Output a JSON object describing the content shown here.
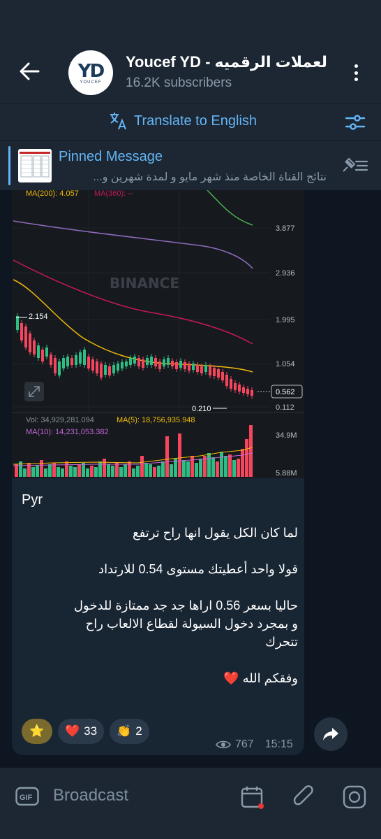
{
  "header": {
    "title": "Youcef YD - لعملات الرقميه",
    "subscribers": "16.2K subscribers",
    "avatar_logo": "YD",
    "avatar_sub": "YOUCEF"
  },
  "translate": {
    "label": "Translate to English"
  },
  "pinned": {
    "title": "Pinned Message",
    "text": "نتائج القناة الخاصة منذ شهر مايو و لمدة شهرين و..."
  },
  "chart": {
    "watermark": "BINANCE",
    "ma200": "MA(200): 4.057",
    "ma360": "MA(360): --",
    "price_labels": [
      "3.877",
      "2.936",
      "1.995",
      "1.054",
      "0.112"
    ],
    "current_price": "0.562",
    "high_label": "2.154",
    "low_label": "0.210",
    "vol": "Vol: 34,929,281.094",
    "vol_ma5": "MA(5): 18,756,935.948",
    "vol_ma10": "MA(10): 14,231,053.382",
    "vol_labels": [
      "34.9M",
      "5.88M"
    ],
    "colors": {
      "up": "#2ebd85",
      "down": "#f6465d",
      "ma_yellow": "#f0b90b",
      "ma_pink": "#c2185b",
      "ma_purple": "#8e6bbf",
      "ma_green": "#4caf50"
    }
  },
  "message": {
    "title_line": "Pyr",
    "lines": [
      "لما كان الكل يقول انها راح ترتفع",
      "",
      "قولا واحد أعطيتك مستوى 0.54 للارتداد",
      "",
      "حاليا بسعر 0.56 اراها جد جد ممتازة للدخول",
      "و بمجرد دخول السيولة لقطاع الالعاب راح",
      "تتحرك",
      "",
      "وفقكم الله ❤️"
    ],
    "reactions": [
      {
        "emoji": "⭐",
        "count": ""
      },
      {
        "emoji": "❤️",
        "count": "33"
      },
      {
        "emoji": "👏",
        "count": "2"
      }
    ],
    "views": "767",
    "time": "15:15"
  },
  "input": {
    "placeholder": "Broadcast",
    "gif_label": "GIF"
  }
}
